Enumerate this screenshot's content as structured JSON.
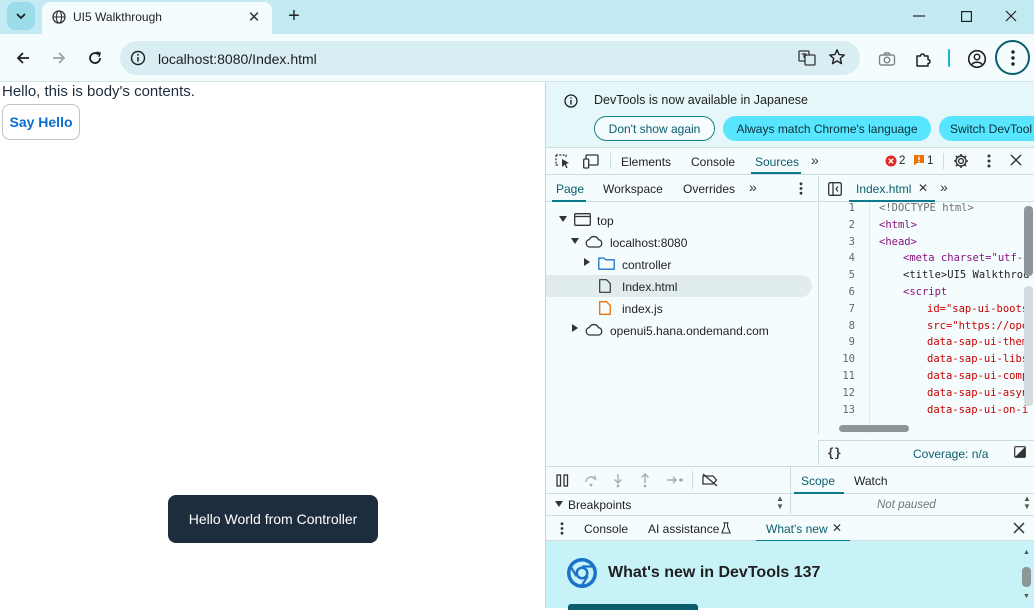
{
  "browser": {
    "tab_title": "UI5 Walkthrough",
    "url": "localhost:8080/Index.html"
  },
  "page": {
    "body_text": "Hello, this is body's contents.",
    "say_hello_label": "Say Hello",
    "toast_text": "Hello World from Controller"
  },
  "devtools": {
    "infobar": {
      "message": "DevTools is now available in Japanese",
      "dont_show_label": "Don't show again",
      "always_match_label": "Always match Chrome's language",
      "switch_label": "Switch DevTool"
    },
    "main_tabs": [
      "Elements",
      "Console",
      "Sources"
    ],
    "active_main_tab": "Sources",
    "error_count": "2",
    "warning_count": "1",
    "sources_tabs": [
      "Page",
      "Workspace",
      "Overrides"
    ],
    "tree": {
      "top": "top",
      "host": "localhost:8080",
      "folder": "controller",
      "file_html": "Index.html",
      "file_js": "index.js",
      "remote_host": "openui5.hana.ondemand.com"
    },
    "editor": {
      "open_file": "Index.html",
      "lines": [
        {
          "n": "1",
          "code": "<!DOCTYPE html>"
        },
        {
          "n": "2",
          "code": "<html>"
        },
        {
          "n": "3",
          "code": "<head>"
        },
        {
          "n": "4",
          "code": "<meta charset=\"utf-8"
        },
        {
          "n": "5",
          "code": "<title>UI5 Walkthrou"
        },
        {
          "n": "6",
          "code": "<script"
        },
        {
          "n": "7",
          "code": "id=\"sap-ui-boots"
        },
        {
          "n": "8",
          "code": "src=\"https://ope"
        },
        {
          "n": "9",
          "code": "data-sap-ui-them"
        },
        {
          "n": "10",
          "code": "data-sap-ui-libs"
        },
        {
          "n": "11",
          "code": "data-sap-ui-comp"
        },
        {
          "n": "12",
          "code": "data-sap-ui-asyn"
        },
        {
          "n": "13",
          "code": "data-sap-ui-on-i"
        }
      ],
      "coverage": "Coverage: n/a"
    },
    "debugger": {
      "breakpoints_label": "Breakpoints",
      "scope_label": "Scope",
      "watch_label": "Watch",
      "not_paused": "Not paused"
    },
    "drawer": {
      "tabs": [
        "Console",
        "AI assistance",
        "What's new"
      ],
      "whats_new_title": "What's new in DevTools 137"
    }
  }
}
